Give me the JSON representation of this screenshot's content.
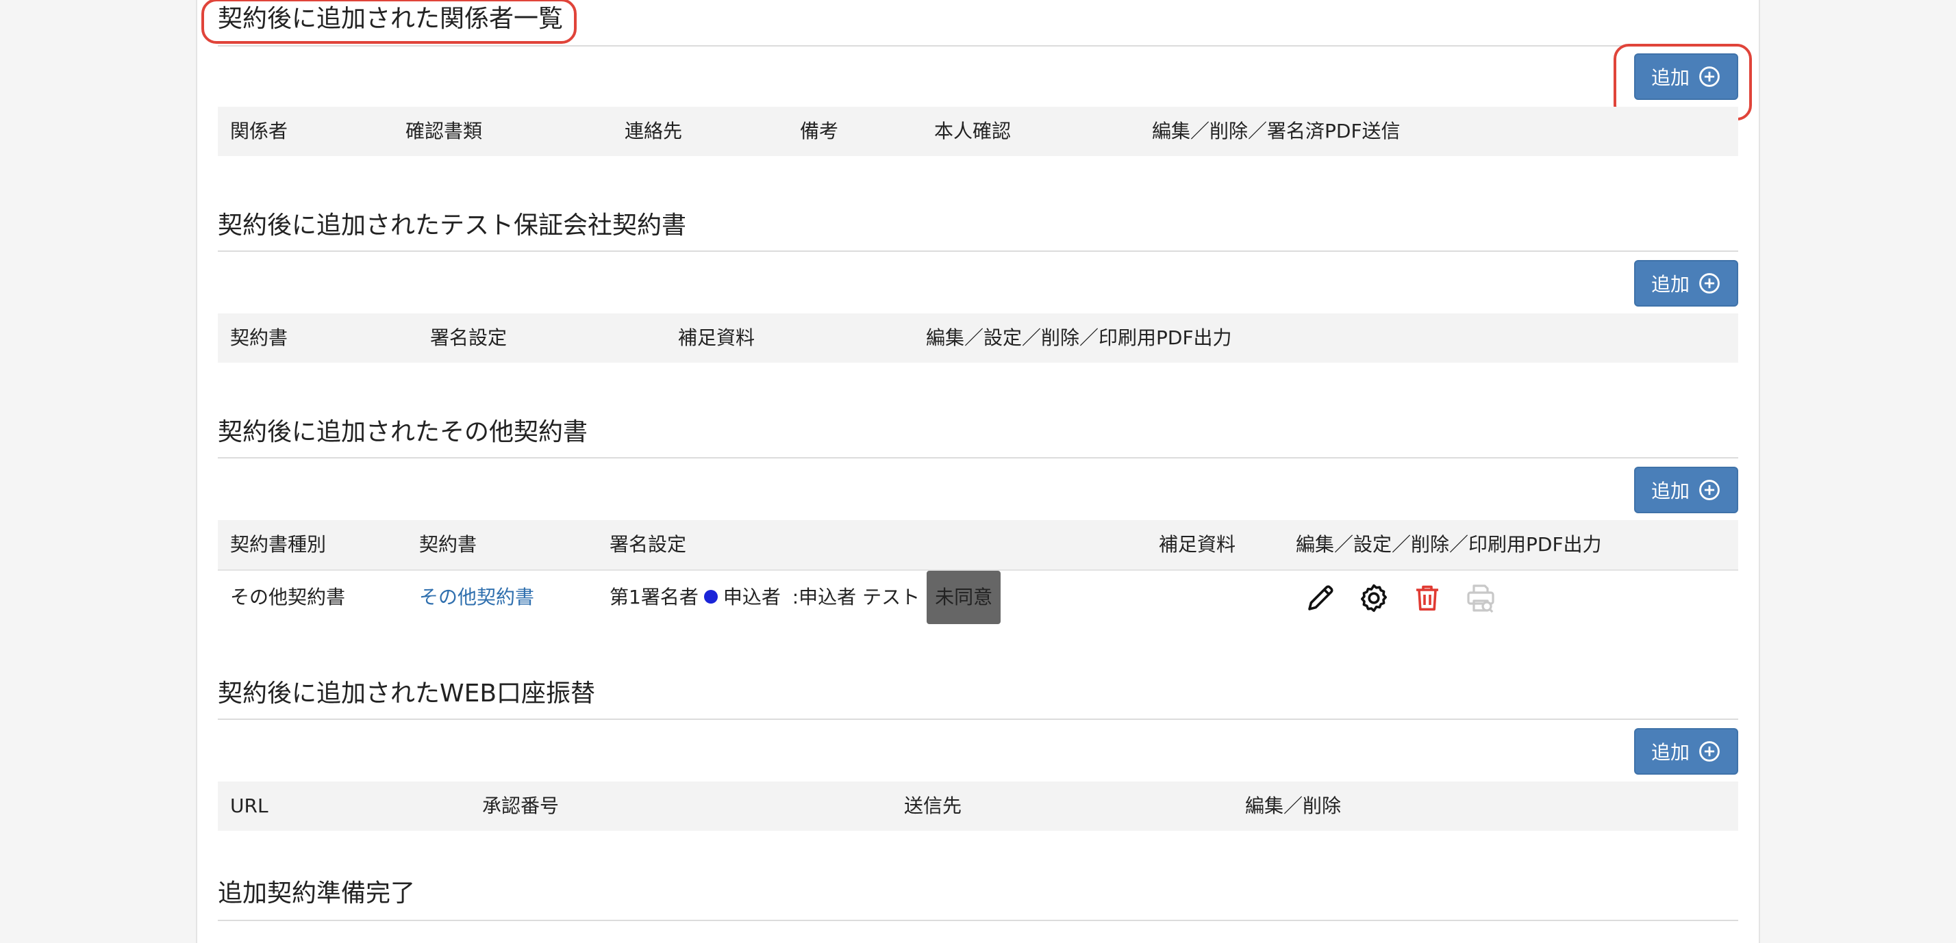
{
  "colors": {
    "accent": "#4a7fb9",
    "highlight": "#e0443a",
    "link": "#2f6fae",
    "danger": "#e03a32",
    "dot": "#1a24d8"
  },
  "add_label": "追加",
  "sections": {
    "parties": {
      "title": "契約後に追加された関係者一覧",
      "columns": [
        "関係者",
        "確認書類",
        "連絡先",
        "備考",
        "本人確認",
        "編集／削除／署名済PDF送信"
      ]
    },
    "guarantor": {
      "title": "契約後に追加されたテスト保証会社契約書",
      "columns": [
        "契約書",
        "署名設定",
        "補足資料",
        "編集／設定／削除／印刷用PDF出力"
      ]
    },
    "other": {
      "title": "契約後に追加されたその他契約書",
      "columns": [
        "契約書種別",
        "契約書",
        "署名設定",
        "補足資料",
        "編集／設定／削除／印刷用PDF出力"
      ],
      "rows": [
        {
          "type": "その他契約書",
          "contract": "その他契約書",
          "signer_order": "第1署名者",
          "signer_role": "申込者",
          "signer_name": ":申込者 テスト",
          "status": "未同意",
          "icons": [
            "edit-icon",
            "settings-icon",
            "delete-icon",
            "print-pdf-icon"
          ]
        }
      ]
    },
    "web": {
      "title": "契約後に追加されたWEB口座振替",
      "columns": [
        "URL",
        "承認番号",
        "送信先",
        "編集／削除"
      ]
    },
    "ready": {
      "title": "追加契約準備完了"
    }
  }
}
